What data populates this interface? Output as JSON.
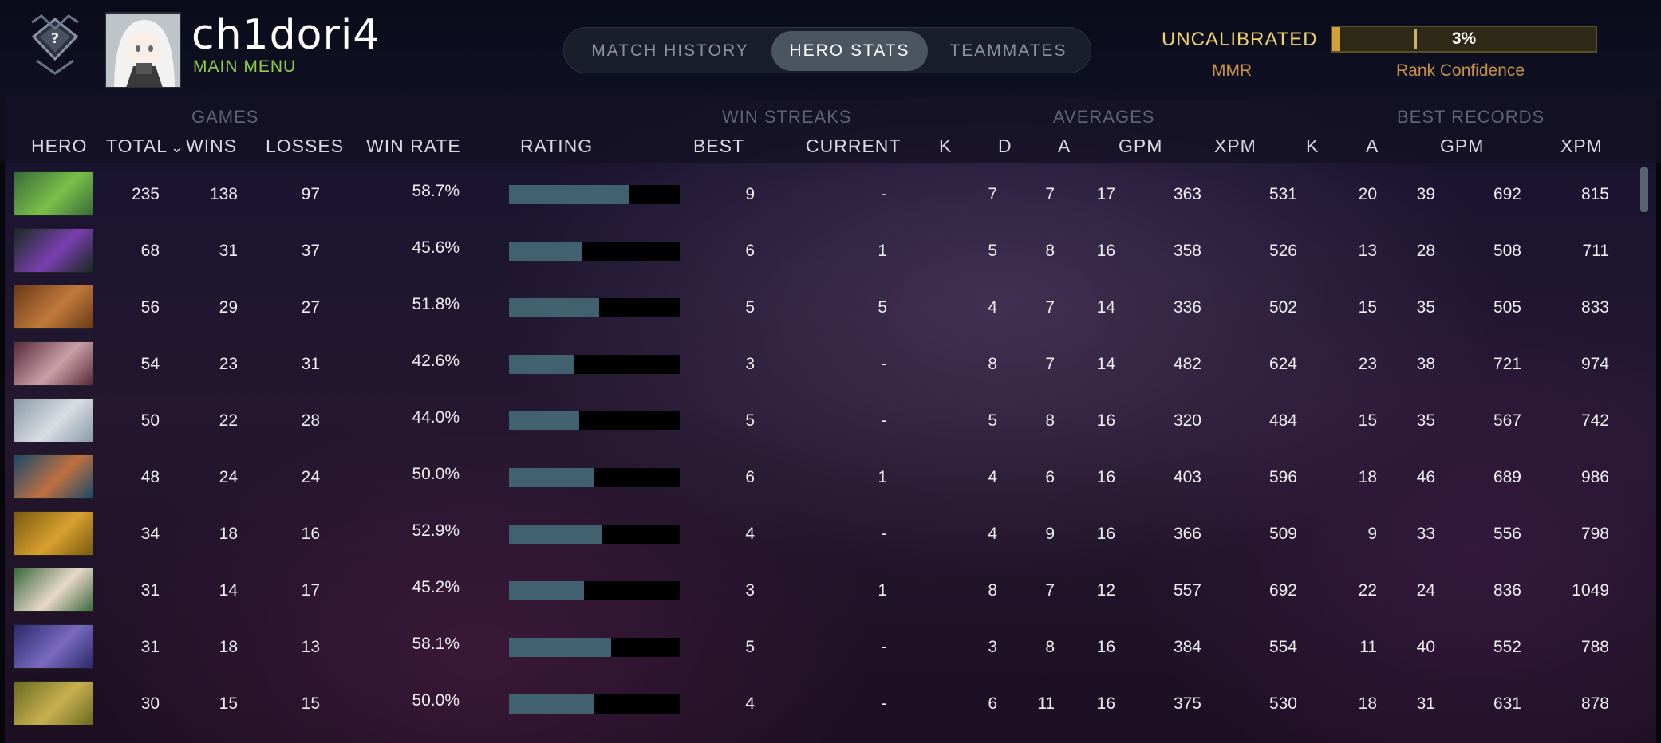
{
  "header": {
    "player_name": "ch1dori4",
    "main_menu": "MAIN MENU",
    "tabs": [
      {
        "label": "MATCH HISTORY",
        "active": false
      },
      {
        "label": "HERO STATS",
        "active": true
      },
      {
        "label": "TEAMMATES",
        "active": false
      }
    ],
    "rank_status": "UNCALIBRATED",
    "mmr_label": "MMR",
    "confidence_value": "3%",
    "confidence_fraction": 0.03,
    "confidence_label": "Rank Confidence"
  },
  "table": {
    "groups": [
      "GAMES",
      "WIN STREAKS",
      "AVERAGES",
      "BEST RECORDS"
    ],
    "columns": [
      "HERO",
      "TOTAL",
      "WINS",
      "LOSSES",
      "WIN RATE",
      "RATING",
      "BEST",
      "CURRENT",
      "K",
      "D",
      "A",
      "GPM",
      "XPM",
      "K",
      "A",
      "GPM",
      "XPM"
    ],
    "sort_indicator": "⌄",
    "rows": [
      {
        "total": "235",
        "wins": "138",
        "losses": "97",
        "winrate": "58.7%",
        "rating": 0.7,
        "best": "9",
        "current": "-",
        "k": "7",
        "d": "7",
        "a": "17",
        "gpm": "363",
        "xpm": "531",
        "bk": "20",
        "ba": "39",
        "bgpm": "692",
        "bxpm": "815"
      },
      {
        "total": "68",
        "wins": "31",
        "losses": "37",
        "winrate": "45.6%",
        "rating": 0.43,
        "best": "6",
        "current": "1",
        "k": "5",
        "d": "8",
        "a": "16",
        "gpm": "358",
        "xpm": "526",
        "bk": "13",
        "ba": "28",
        "bgpm": "508",
        "bxpm": "711"
      },
      {
        "total": "56",
        "wins": "29",
        "losses": "27",
        "winrate": "51.8%",
        "rating": 0.53,
        "best": "5",
        "current": "5",
        "k": "4",
        "d": "7",
        "a": "14",
        "gpm": "336",
        "xpm": "502",
        "bk": "15",
        "ba": "35",
        "bgpm": "505",
        "bxpm": "833"
      },
      {
        "total": "54",
        "wins": "23",
        "losses": "31",
        "winrate": "42.6%",
        "rating": 0.38,
        "best": "3",
        "current": "-",
        "k": "8",
        "d": "7",
        "a": "14",
        "gpm": "482",
        "xpm": "624",
        "bk": "23",
        "ba": "38",
        "bgpm": "721",
        "bxpm": "974"
      },
      {
        "total": "50",
        "wins": "22",
        "losses": "28",
        "winrate": "44.0%",
        "rating": 0.41,
        "best": "5",
        "current": "-",
        "k": "5",
        "d": "8",
        "a": "16",
        "gpm": "320",
        "xpm": "484",
        "bk": "15",
        "ba": "35",
        "bgpm": "567",
        "bxpm": "742"
      },
      {
        "total": "48",
        "wins": "24",
        "losses": "24",
        "winrate": "50.0%",
        "rating": 0.5,
        "best": "6",
        "current": "1",
        "k": "4",
        "d": "6",
        "a": "16",
        "gpm": "403",
        "xpm": "596",
        "bk": "18",
        "ba": "46",
        "bgpm": "689",
        "bxpm": "986"
      },
      {
        "total": "34",
        "wins": "18",
        "losses": "16",
        "winrate": "52.9%",
        "rating": 0.54,
        "best": "4",
        "current": "-",
        "k": "4",
        "d": "9",
        "a": "16",
        "gpm": "366",
        "xpm": "509",
        "bk": "9",
        "ba": "33",
        "bgpm": "556",
        "bxpm": "798"
      },
      {
        "total": "31",
        "wins": "14",
        "losses": "17",
        "winrate": "45.2%",
        "rating": 0.44,
        "best": "3",
        "current": "1",
        "k": "8",
        "d": "7",
        "a": "12",
        "gpm": "557",
        "xpm": "692",
        "bk": "22",
        "ba": "24",
        "bgpm": "836",
        "bxpm": "1049"
      },
      {
        "total": "31",
        "wins": "18",
        "losses": "13",
        "winrate": "58.1%",
        "rating": 0.6,
        "best": "5",
        "current": "-",
        "k": "3",
        "d": "8",
        "a": "16",
        "gpm": "384",
        "xpm": "554",
        "bk": "11",
        "ba": "40",
        "bgpm": "552",
        "bxpm": "788"
      },
      {
        "total": "30",
        "wins": "15",
        "losses": "15",
        "winrate": "50.0%",
        "rating": 0.5,
        "best": "4",
        "current": "-",
        "k": "6",
        "d": "11",
        "a": "16",
        "gpm": "375",
        "xpm": "530",
        "bk": "18",
        "ba": "31",
        "bgpm": "631",
        "bxpm": "878"
      }
    ],
    "hero_colors": [
      [
        "#3a6a3a",
        "#7ac04a"
      ],
      [
        "#1a2a20",
        "#7a3fb0"
      ],
      [
        "#6a3a18",
        "#c07a3a"
      ],
      [
        "#5a2a3a",
        "#c8a0a8"
      ],
      [
        "#8a9aa8",
        "#d8dde2"
      ],
      [
        "#1a4a6a",
        "#c07040"
      ],
      [
        "#7a5a10",
        "#d8a030"
      ],
      [
        "#3a6a3a",
        "#e8d8c8"
      ],
      [
        "#2a2a6a",
        "#7a6ac0"
      ],
      [
        "#6a6a20",
        "#c8b050"
      ]
    ]
  }
}
